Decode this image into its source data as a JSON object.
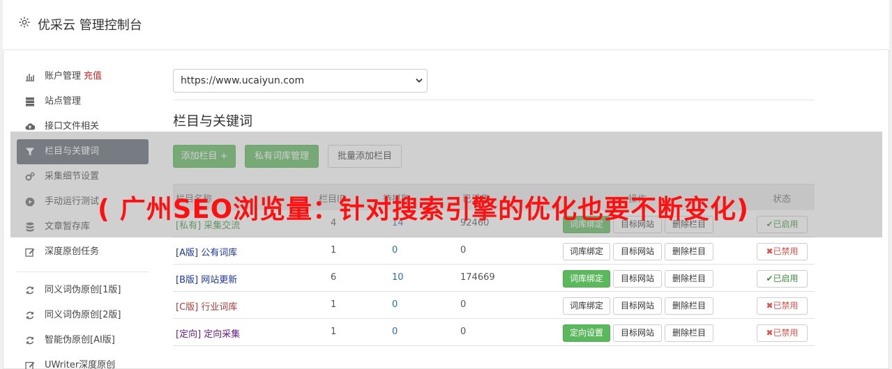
{
  "header": {
    "title": "优采云 管理控制台"
  },
  "sidebar": {
    "items": [
      {
        "label": "账户管理",
        "extra": "充值",
        "icon": "bar-chart-icon"
      },
      {
        "label": "站点管理",
        "icon": "server-icon"
      },
      {
        "label": "接口文件相关",
        "icon": "cloud-upload-icon"
      },
      {
        "label": "栏目与关键词",
        "icon": "filter-icon",
        "active": true
      },
      {
        "label": "采集细节设置",
        "icon": "cogs-icon"
      },
      {
        "label": "手动运行测试",
        "icon": "play-circle-icon"
      },
      {
        "label": "文章暂存库",
        "icon": "database-icon"
      },
      {
        "label": "深度原创任务",
        "icon": "edit-icon"
      }
    ],
    "items2": [
      {
        "label": "同义词伪原创[1版]",
        "icon": "refresh-icon"
      },
      {
        "label": "同义词伪原创[2版]",
        "icon": "refresh-icon"
      },
      {
        "label": "智能伪原创[AI版]",
        "icon": "refresh-icon"
      },
      {
        "label": "UWriter深度原创",
        "icon": "edit-icon"
      }
    ]
  },
  "main": {
    "site_select": "https://www.ucaiyun.com",
    "section_title": "栏目与关键词",
    "buttons": {
      "add": "添加栏目 +",
      "private": "私有词库管理",
      "batch": "批量添加栏目"
    },
    "table": {
      "headers": [
        "栏目名称",
        "栏目ID",
        "待抓取",
        "已采集",
        "操作",
        "状态"
      ],
      "rows": [
        {
          "tag": "[私有]",
          "name": "采集交流",
          "id": "4",
          "pending": "14",
          "collected": "92460",
          "action1": "词库绑定",
          "action2": "目标网站",
          "action3": "删除栏目",
          "status": "✔已启用",
          "enabled": true,
          "color": "#3c8f3c",
          "action1_green": true
        },
        {
          "tag": "[A版]",
          "name": "公有词库",
          "id": "1",
          "pending": "0",
          "collected": "0",
          "action1": "词库绑定",
          "action2": "目标网站",
          "action3": "删除栏目",
          "status": "✖已禁用",
          "enabled": false,
          "color": "#1a33a8",
          "action1_green": false
        },
        {
          "tag": "[B版]",
          "name": "网站更新",
          "id": "6",
          "pending": "10",
          "collected": "174669",
          "action1": "词库绑定",
          "action2": "目标网站",
          "action3": "删除栏目",
          "status": "✔已启用",
          "enabled": true,
          "color": "#1a33a8",
          "action1_green": true
        },
        {
          "tag": "[C版]",
          "name": "行业词库",
          "id": "1",
          "pending": "0",
          "collected": "0",
          "action1": "词库绑定",
          "action2": "目标网站",
          "action3": "删除栏目",
          "status": "✖已禁用",
          "enabled": false,
          "color": "#b03a3a",
          "action1_green": false
        },
        {
          "tag": "[定向]",
          "name": "定向采集",
          "id": "1",
          "pending": "0",
          "collected": "0",
          "action1": "定向设置",
          "action2": "目标网站",
          "action3": "删除栏目",
          "status": "✖已禁用",
          "enabled": false,
          "color": "#6a1b9a",
          "action1_green": true
        }
      ]
    }
  },
  "watermark": {
    "text": "( 广州SEO浏览量：针对搜索引擎的优化也要不断变化)"
  }
}
